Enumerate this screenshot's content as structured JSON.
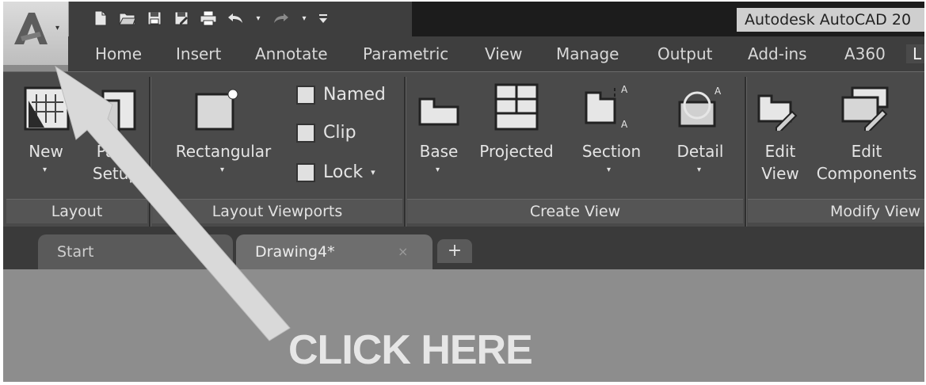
{
  "window": {
    "title": "Autodesk AutoCAD 20"
  },
  "app_button": {
    "icon": "autocad-a-logo",
    "caret": "▾"
  },
  "quick_access": {
    "icons": [
      "new-icon",
      "open-icon",
      "save-icon",
      "save-as-icon",
      "plot-icon",
      "undo-icon",
      "redo-icon",
      "customize-icon"
    ]
  },
  "menu": {
    "tabs": [
      {
        "label": "Home"
      },
      {
        "label": "Insert"
      },
      {
        "label": "Annotate"
      },
      {
        "label": "Parametric"
      },
      {
        "label": "View"
      },
      {
        "label": "Manage"
      },
      {
        "label": "Output"
      },
      {
        "label": "Add-ins"
      },
      {
        "label": "A360"
      },
      {
        "label": "L"
      }
    ]
  },
  "ribbon": {
    "layout_panel": {
      "title": "Layout",
      "new_label": "New",
      "page_setup_label_1": "Page",
      "page_setup_label_2": "Setup"
    },
    "viewports_panel": {
      "title": "Layout Viewports",
      "rectangular_label": "Rectangular",
      "named_label": "Named",
      "clip_label": "Clip",
      "lock_label": "Lock"
    },
    "create_view_panel": {
      "title": "Create View",
      "base_label": "Base",
      "projected_label": "Projected",
      "section_label": "Section",
      "detail_label": "Detail"
    },
    "modify_view_panel": {
      "title": "Modify View",
      "edit_view_label_1": "Edit",
      "edit_view_label_2": "View",
      "edit_components_label_1": "Edit",
      "edit_components_label_2": "Components"
    }
  },
  "documents": {
    "tabs": [
      {
        "label": "Start"
      },
      {
        "label": "Drawing4*"
      }
    ],
    "close_glyph": "×",
    "add_glyph": "+"
  },
  "annotation": {
    "callout": "CLICK HERE"
  },
  "colors": {
    "ribbon_bg": "#4a4a4a",
    "menubar_bg": "#3e3e3e",
    "canvas_bg": "#8d8d8d",
    "arrow": "#d9d9d9"
  }
}
